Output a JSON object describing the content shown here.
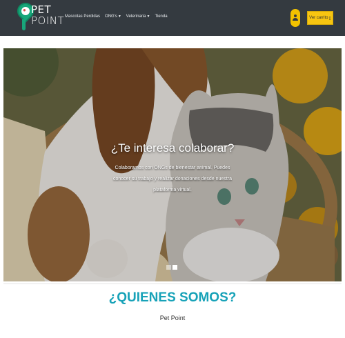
{
  "brand": {
    "line1": "PET",
    "line2": "POINT"
  },
  "nav": {
    "items": [
      {
        "label": "Mascotas Perdidas",
        "dropdown": false
      },
      {
        "label": "ONG's",
        "dropdown": true
      },
      {
        "label": "Veterinaria",
        "dropdown": true
      },
      {
        "label": "Tienda",
        "dropdown": false
      }
    ],
    "cart_label": "Ver carrito"
  },
  "hero": {
    "title": "¿Te interesa colaborar?",
    "text": "Colaboramos con ONGs de bienestar animal. Puedes conocer su trabajo y realizar donaciones desde nuestra plataforma virtual.",
    "slide_count": 2,
    "active_slide": 2
  },
  "about": {
    "title": "¿QUIENES SOMOS?",
    "subtitle": "Pet Point"
  },
  "colors": {
    "navbar": "#343a40",
    "accent_yellow": "#f7c511",
    "accent_teal": "#17a2b8",
    "logo_green": "#18a67a"
  },
  "icons": [
    "paw-icon",
    "user-icon",
    "cart-icon",
    "chevron-down-icon"
  ]
}
